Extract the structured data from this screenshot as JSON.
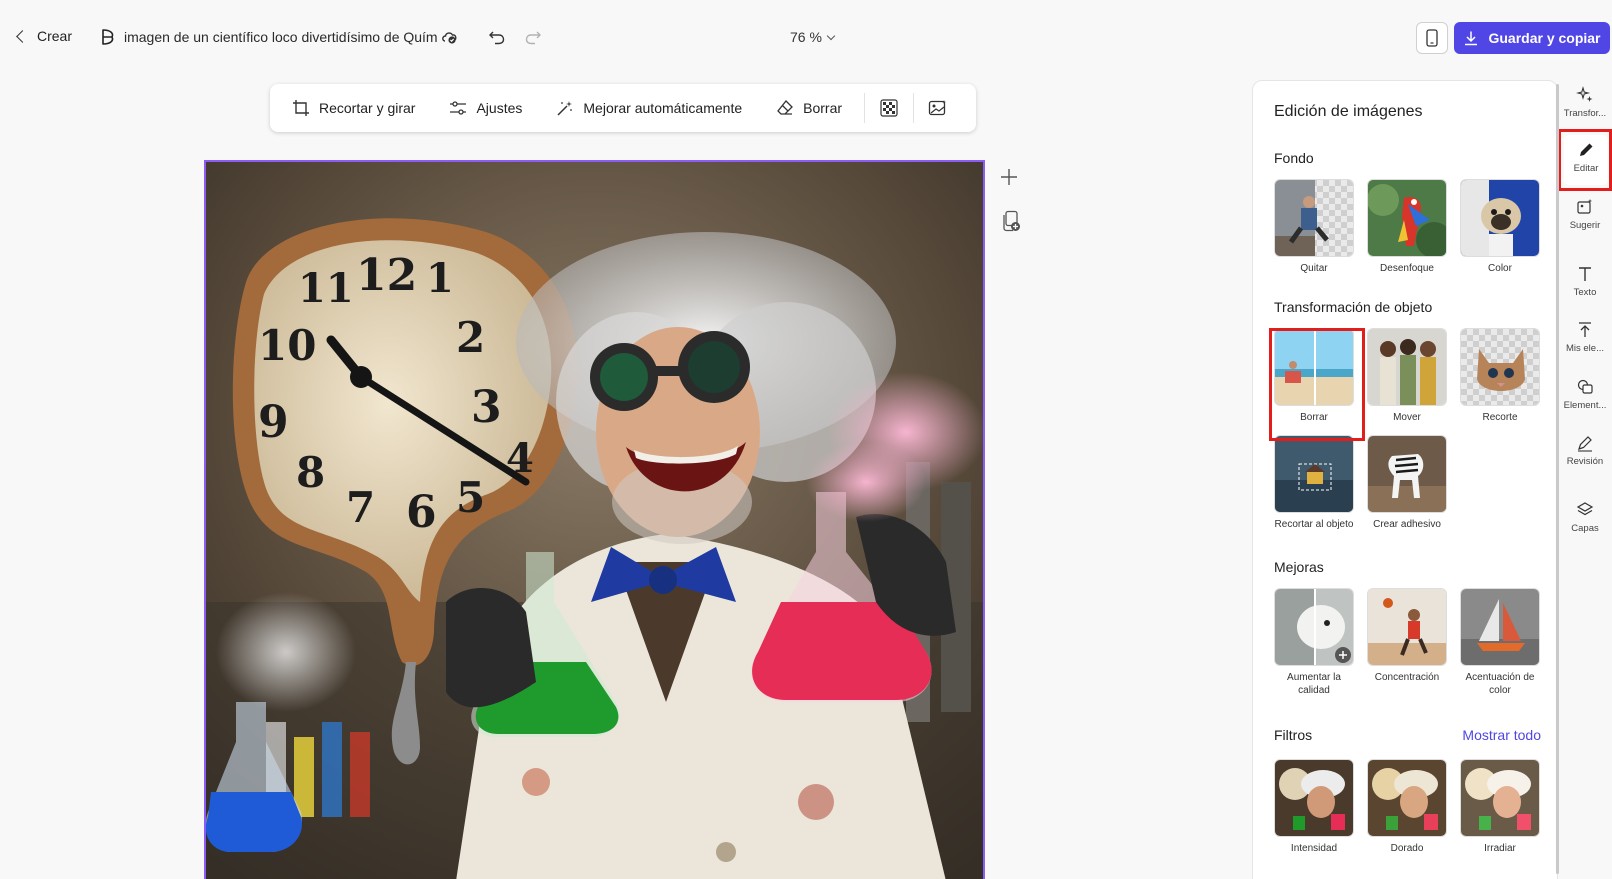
{
  "topbar": {
    "back_label": "Crear",
    "doc_title": "imagen de un científico loco divertidísimo de Quím",
    "zoom": "76 %",
    "save_label": "Guardar y copiar"
  },
  "toolbar": {
    "crop_label": "Recortar y girar",
    "adjust_label": "Ajustes",
    "enhance_label": "Mejorar automáticamente",
    "erase_label": "Borrar"
  },
  "panel": {
    "title": "Edición de imágenes",
    "background": {
      "title": "Fondo",
      "items": [
        "Quitar",
        "Desenfoque",
        "Color"
      ]
    },
    "transform": {
      "title": "Transformación de objeto",
      "items": [
        "Borrar",
        "Mover",
        "Recorte",
        "Recortar al objeto",
        "Crear adhesivo"
      ]
    },
    "improvements": {
      "title": "Mejoras",
      "items": [
        "Aumentar la calidad",
        "Concentración",
        "Acentuación de color"
      ]
    },
    "filters": {
      "title": "Filtros",
      "show_all": "Mostrar todo",
      "items": [
        "Intensidad",
        "Dorado",
        "Irradiar"
      ]
    }
  },
  "rail": {
    "items": [
      "Transfor...",
      "Editar",
      "Sugerir",
      "Texto",
      "Mis ele...",
      "Element...",
      "Revisión",
      "Capas"
    ]
  },
  "colors": {
    "accent": "#4f46e5",
    "canvas_border": "#8b5cf6",
    "highlight": "#e31c1c"
  }
}
